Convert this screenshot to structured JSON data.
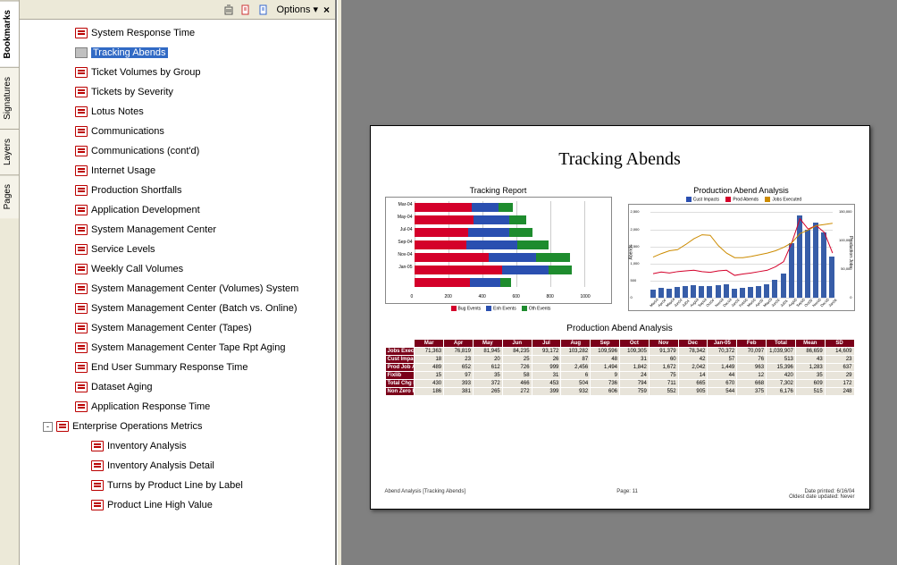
{
  "side_tabs": [
    "Bookmarks",
    "Signatures",
    "Layers",
    "Pages"
  ],
  "active_side_tab": 0,
  "toolbar": {
    "options_label": "Options"
  },
  "bookmarks": {
    "flat_items": [
      {
        "label": "System Response Time",
        "level": 1,
        "icon": "pdf"
      },
      {
        "label": "Tracking Abends",
        "level": 1,
        "icon": "gray",
        "selected": true
      },
      {
        "label": "Ticket Volumes by Group",
        "level": 1,
        "icon": "pdf"
      },
      {
        "label": "Tickets by Severity",
        "level": 1,
        "icon": "pdf"
      },
      {
        "label": "Lotus Notes",
        "level": 1,
        "icon": "pdf"
      },
      {
        "label": "Communications",
        "level": 1,
        "icon": "pdf"
      },
      {
        "label": "Communications (cont'd)",
        "level": 1,
        "icon": "pdf"
      },
      {
        "label": "Internet Usage",
        "level": 1,
        "icon": "pdf"
      },
      {
        "label": "Production Shortfalls",
        "level": 1,
        "icon": "pdf"
      },
      {
        "label": "Application Development",
        "level": 1,
        "icon": "pdf"
      },
      {
        "label": "System Management Center",
        "level": 1,
        "icon": "pdf"
      },
      {
        "label": "Service Levels",
        "level": 1,
        "icon": "pdf"
      },
      {
        "label": "Weekly Call Volumes",
        "level": 1,
        "icon": "pdf"
      },
      {
        "label": "System Management Center (Volumes) System",
        "level": 1,
        "icon": "pdf"
      },
      {
        "label": "System Management Center (Batch vs. Online)",
        "level": 1,
        "icon": "pdf"
      },
      {
        "label": "System Management Center (Tapes)",
        "level": 1,
        "icon": "pdf"
      },
      {
        "label": "System Management Center  Tape Rpt Aging",
        "level": 1,
        "icon": "pdf"
      },
      {
        "label": "End User Summary Response Time",
        "level": 1,
        "icon": "pdf"
      },
      {
        "label": "Dataset Aging",
        "level": 1,
        "icon": "pdf"
      },
      {
        "label": "Application Response Time",
        "level": 1,
        "icon": "pdf"
      },
      {
        "label": "Enterprise Operations Metrics",
        "level": 0,
        "icon": "pdf",
        "expander": "-"
      },
      {
        "label": "Inventory Analysis",
        "level": 2,
        "icon": "pdf"
      },
      {
        "label": "Inventory Analysis Detail",
        "level": 2,
        "icon": "pdf"
      },
      {
        "label": "Turns by Product Line by Label",
        "level": 2,
        "icon": "pdf"
      },
      {
        "label": "Product Line High Value",
        "level": 2,
        "icon": "pdf"
      }
    ]
  },
  "document": {
    "title": "Tracking Abends",
    "section_title": "Production Abend Analysis",
    "footer_left": "Abend Analysis [Tracking Abends]",
    "footer_center": "Page:  11",
    "footer_right1": "Date printed: 6/16/04",
    "footer_right2": "Oldest date updated: Never"
  },
  "chart_data": [
    {
      "type": "bar",
      "orientation": "horizontal-stacked",
      "title": "Tracking Report",
      "categories": [
        "Mar-04",
        "May-04",
        "Jul-04",
        "Sep-04",
        "Nov-04",
        "Jan-05"
      ],
      "series": [
        {
          "name": "Bug Events",
          "color": "#d4002a",
          "values": [
            340,
            350,
            320,
            310,
            440,
            520,
            330
          ]
        },
        {
          "name": "Enh Events",
          "color": "#2a4fb0",
          "values": [
            160,
            210,
            240,
            300,
            280,
            270,
            180
          ]
        },
        {
          "name": "Oth Events",
          "color": "#1e8c2e",
          "values": [
            80,
            100,
            140,
            180,
            200,
            140,
            60
          ]
        }
      ],
      "xlim": [
        0,
        1000
      ],
      "xticks": [
        0,
        200,
        400,
        600,
        800,
        1000
      ]
    },
    {
      "type": "combo",
      "title": "Production Abend Analysis",
      "legend": [
        {
          "name": "Cust Impacts",
          "color": "#2a4fb0",
          "type": "bar"
        },
        {
          "name": "Prod Abends",
          "color": "#d4002a",
          "type": "line"
        },
        {
          "name": "Jobs Executed",
          "color": "#cc8b00",
          "type": "line"
        }
      ],
      "x": [
        "Mar04",
        "Apr04",
        "May04",
        "Jun04",
        "Jul04",
        "Aug04",
        "Sep04",
        "Oct04",
        "Nov04",
        "Dec04",
        "Jan05",
        "Feb05",
        "Mar05",
        "Apr05",
        "May05",
        "Jun05",
        "Jul05",
        "Aug05",
        "Sep05",
        "Oct05",
        "Nov05",
        "Dec05",
        "Jan06"
      ],
      "bars": [
        250,
        300,
        280,
        320,
        340,
        380,
        360,
        340,
        380,
        400,
        260,
        300,
        320,
        360,
        400,
        520,
        700,
        1600,
        2400,
        2000,
        2200,
        1900,
        1200
      ],
      "line_prod": [
        700,
        750,
        720,
        760,
        780,
        800,
        760,
        740,
        780,
        800,
        650,
        690,
        720,
        760,
        800,
        900,
        1050,
        1600,
        2300,
        2000,
        2100,
        1900,
        1300
      ],
      "line_jobs": [
        71000,
        77000,
        82000,
        84000,
        93000,
        103000,
        110000,
        109000,
        91000,
        78000,
        70000,
        70000,
        72000,
        75000,
        78000,
        82000,
        88000,
        96000,
        112000,
        118000,
        126000,
        128000,
        130000
      ],
      "ylabel_left": "Abends",
      "ylabel_right": "Production Jobs",
      "ylim_left": [
        0,
        2500
      ],
      "ylim_right": [
        0,
        150000
      ]
    }
  ],
  "table": {
    "columns": [
      "Mar",
      "Apr",
      "May",
      "Jun",
      "Jul",
      "Aug",
      "Sep",
      "Oct",
      "Nov",
      "Dec",
      "Jan-05",
      "Feb",
      "Total",
      "Mean",
      "SD"
    ],
    "rows": [
      {
        "name": "Jobs Executed",
        "v": [
          "71,363",
          "76,819",
          "81,945",
          "84,235",
          "93,172",
          "103,282",
          "109,596",
          "109,305",
          "91,379",
          "78,342",
          "70,372",
          "70,097",
          "1,039,907",
          "86,659",
          "14,609"
        ]
      },
      {
        "name": "Cust Impacts",
        "v": [
          "18",
          "23",
          "20",
          "25",
          "26",
          "87",
          "48",
          "31",
          "60",
          "42",
          "57",
          "76",
          "513",
          "43",
          "23"
        ]
      },
      {
        "name": "Prod Job Abends",
        "v": [
          "489",
          "652",
          "612",
          "726",
          "999",
          "2,456",
          "1,494",
          "1,842",
          "1,672",
          "2,042",
          "1,449",
          "963",
          "15,396",
          "1,283",
          "637"
        ]
      },
      {
        "name": "Fixlib",
        "v": [
          "15",
          "97",
          "35",
          "58",
          "31",
          "6",
          "9",
          "24",
          "75",
          "14",
          "44",
          "12",
          "420",
          "35",
          "29"
        ]
      },
      {
        "name": "Total Chg Reqs",
        "v": [
          "430",
          "393",
          "372",
          "466",
          "453",
          "504",
          "736",
          "794",
          "711",
          "665",
          "670",
          "668",
          "7,302",
          "609",
          "172"
        ]
      },
      {
        "name": "Non Zero RC",
        "v": [
          "186",
          "381",
          "265",
          "272",
          "399",
          "932",
          "606",
          "759",
          "552",
          "905",
          "544",
          "375",
          "6,176",
          "515",
          "248"
        ]
      }
    ]
  },
  "colors": {
    "red": "#d4002a",
    "blue": "#2a4fb0",
    "green": "#1e8c2e",
    "maroon": "#7a0019",
    "orange": "#cc8b00"
  }
}
